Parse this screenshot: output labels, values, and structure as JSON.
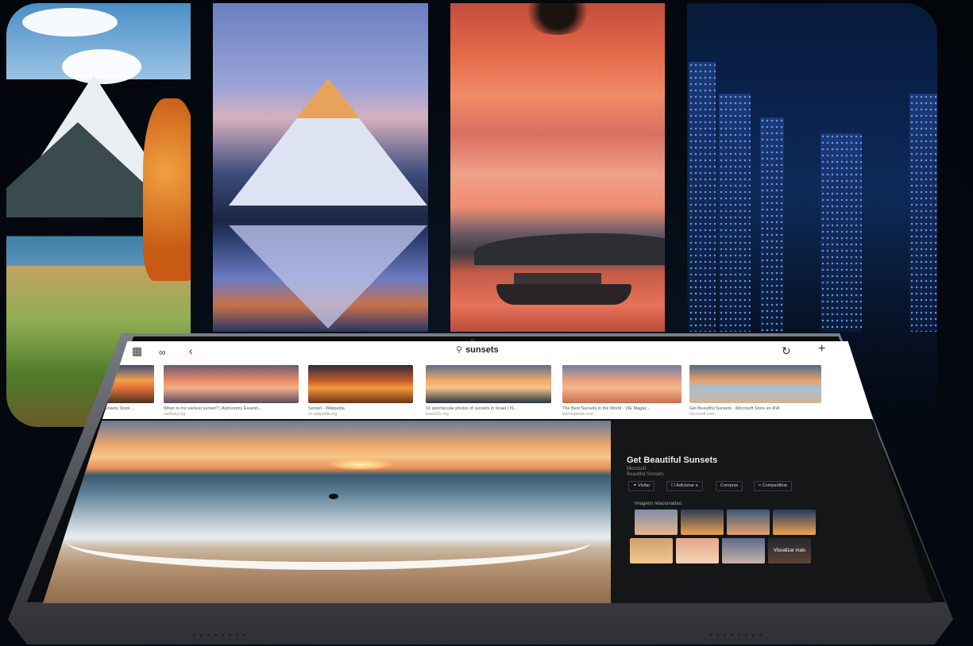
{
  "browser": {
    "search_query": "sunsets",
    "icons": [
      "collections-icon",
      "reader-icon",
      "back-icon",
      "refresh-icon",
      "new-tab-icon"
    ]
  },
  "results": [
    {
      "caption": "most beautiful sunsets Stock ...",
      "source": "",
      "colors": [
        "#3a4e78",
        "#f2a04e",
        "#e46f35",
        "#4a3325"
      ]
    },
    {
      "caption": "When is my earliest sunset? | Astronomy Essenti...",
      "source": "earthsky.org",
      "colors": [
        "#6b5b7d",
        "#e58a64",
        "#f3b085",
        "#5b4a63"
      ]
    },
    {
      "caption": "Sunset - Wikipedia",
      "source": "en.wikipedia.org",
      "colors": [
        "#2d2a3a",
        "#c05a2a",
        "#f59a3a",
        "#6a3218"
      ]
    },
    {
      "caption": "16 spectacular photos of sunsets in Israel | IS...",
      "source": "israel21c.org",
      "colors": [
        "#5b6e96",
        "#f0a968",
        "#f3c489",
        "#263447"
      ]
    },
    {
      "caption": "The Best Sunsets in the World - VIE Magaz...",
      "source": "viemagazine.com",
      "colors": [
        "#6d7fa8",
        "#e9a080",
        "#f2b68e",
        "#c96e4e"
      ]
    },
    {
      "caption": "Get Beautiful Sunsets - Microsoft Store en-KW",
      "source": "microsoft.com",
      "colors": [
        "#4d6b8f",
        "#e7a06a",
        "#a7c0d0",
        "#d2b494"
      ]
    }
  ],
  "detail": {
    "title": "Get Beautiful Sunsets",
    "publisher": "Microsoft",
    "subtitle": "Beautiful Sunsets",
    "actions": [
      {
        "icon": "visit-icon",
        "label": "Visitar"
      },
      {
        "icon": "add-icon",
        "label": "Adicionar a"
      },
      {
        "icon": "",
        "label": "Compras"
      },
      {
        "icon": "share-icon",
        "label": "Compartilhar"
      }
    ],
    "related_heading": "Imagens relacionadas:",
    "see_more": "Visualizar mais",
    "close_icon": "close-icon"
  },
  "related_thumbs": [
    [
      "#7e8eaa",
      "#e9b48c"
    ],
    [
      "#2b3d55",
      "#f0a050"
    ],
    [
      "#3a5878",
      "#e7a070"
    ],
    [
      "#1e3a66",
      "#f3a34a"
    ],
    [
      "#d0a070",
      "#f4c890"
    ],
    [
      "#e3a78a",
      "#f6d2b6"
    ],
    [
      "#5b6b8f",
      "#c9b2a8"
    ],
    [
      "#3d3a42",
      "#8a6a5a"
    ]
  ]
}
